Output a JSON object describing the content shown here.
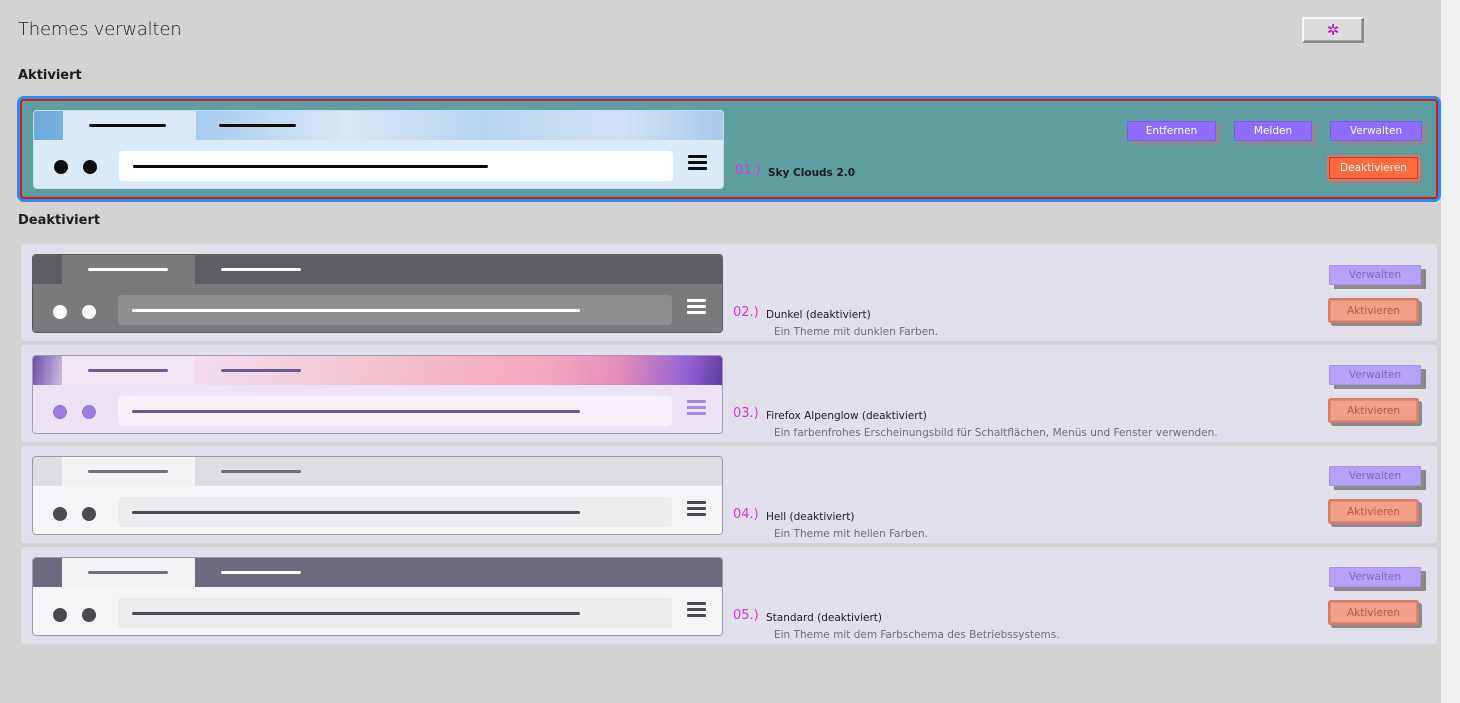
{
  "header": {
    "title": "Themes verwalten",
    "settings_icon": "gear-icon",
    "settings_glyph": "✲"
  },
  "sections": {
    "enabled": "Aktiviert",
    "disabled": "Deaktiviert"
  },
  "active_theme": {
    "number": "01.)",
    "name": "Sky Clouds 2.0",
    "buttons": {
      "remove": "Entfernen",
      "report": "Melden",
      "manage": "Verwalten",
      "disable": "Deaktivieren"
    }
  },
  "disabled_themes": [
    {
      "number": "02.)",
      "name": "Dunkel (deaktiviert)",
      "description": "Ein Theme mit dunklen Farben.",
      "manage": "Verwalten",
      "enable": "Aktivieren"
    },
    {
      "number": "03.)",
      "name": "Firefox Alpenglow (deaktiviert)",
      "description": "Ein farbenfrohes Erscheinungsbild für Schaltflächen, Menüs und Fenster verwenden.",
      "manage": "Verwalten",
      "enable": "Aktivieren"
    },
    {
      "number": "04.)",
      "name": "Hell (deaktiviert)",
      "description": "Ein Theme mit hellen Farben.",
      "manage": "Verwalten",
      "enable": "Aktivieren"
    },
    {
      "number": "05.)",
      "name": "Standard (deaktiviert)",
      "description": "Ein Theme mit dem Farbschema des Betriebssystems.",
      "manage": "Verwalten",
      "enable": "Aktivieren"
    }
  ],
  "colors": {
    "accent_number": "#dd33dd",
    "button_violet": "#8f6bff",
    "button_orange": "#ff6a3d",
    "active_card": "#5f9ea0",
    "focus_ring": "#2d8cf0"
  }
}
